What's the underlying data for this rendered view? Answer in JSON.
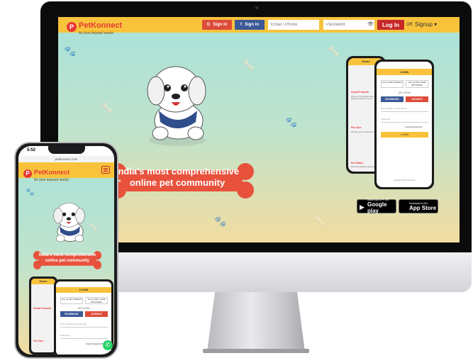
{
  "site": {
    "brand": "PetKonnect",
    "tagline": "for love beyond words",
    "google_signin": "Sign in",
    "facebook_signin": "Sign in",
    "email_placeholder": "Email / Phone",
    "password_placeholder": "Password",
    "login_label": "Log In",
    "or_label": "OR",
    "signup_label": "Signup ▾",
    "hero_line1": "India's most comprehensive",
    "hero_line2": "online pet community",
    "google_play": {
      "small": "ANDROID APP ON",
      "big": "Google play"
    },
    "app_store": {
      "small": "Download on the",
      "big": "App Store"
    }
  },
  "phone": {
    "time": "5:52",
    "url": "petkonnect.com",
    "hero_line1": "India's most comprehensive",
    "hero_line2": "online pet community"
  },
  "login_sheet": {
    "home": "Home",
    "title": "LOGIN",
    "join_parent": "Join as PET PARENT",
    "join_provider": "Join as PET CARE PROVIDER",
    "or_login": "OR LOGIN",
    "facebook": "FACEBOOK",
    "google": "GOOGLE",
    "email": "Enter Mobile Number/Email",
    "password": "Password",
    "forgot": "Forgot Password?",
    "submit": "LOGIN",
    "copyright": "Copyright 2018 PetKonnect",
    "side": [
      {
        "title": "Social Petwork",
        "desc": "There are no strangers here, only friends you haven't met yet"
      },
      {
        "title": "Pet-Care",
        "desc": "We care your furry friends in every way"
      },
      {
        "title": "Pet Affairs",
        "desc": "We create Adoption awareness"
      }
    ]
  },
  "colors": {
    "header": "#f8c33b",
    "brand_red": "#e53935",
    "login_red": "#c62828",
    "facebook": "#3b5998",
    "google": "#dd4b39"
  }
}
